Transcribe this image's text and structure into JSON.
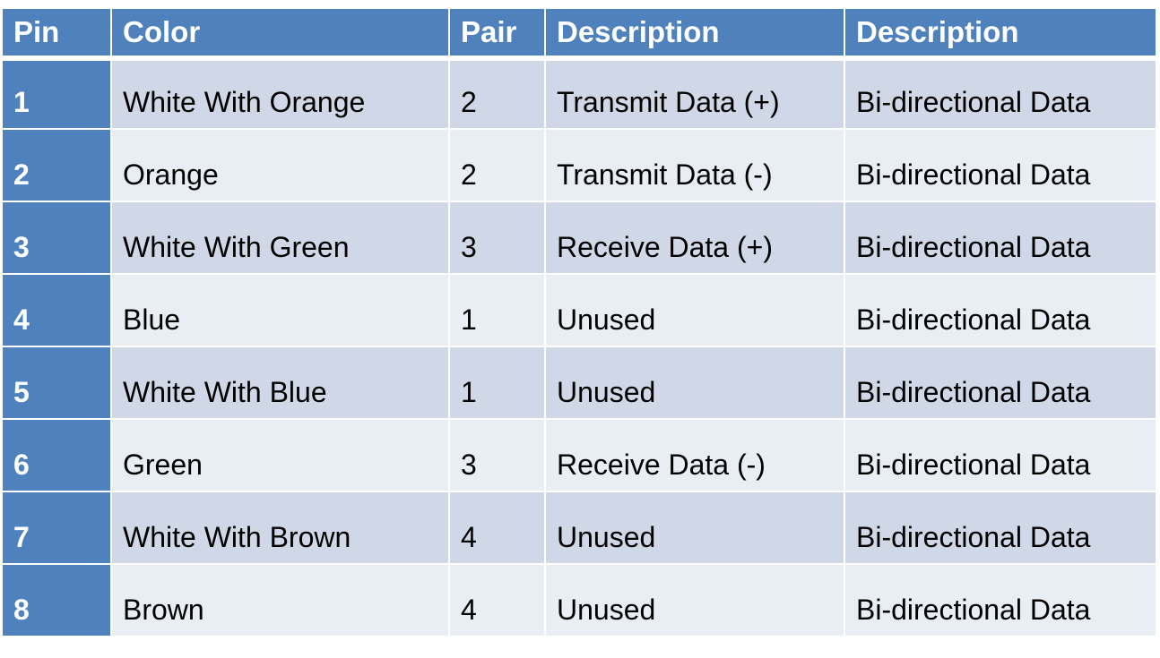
{
  "table": {
    "headers": [
      "Pin",
      "Color",
      "Pair",
      "Description",
      "Description"
    ],
    "rows": [
      [
        "1",
        "White With Orange",
        "2",
        "Transmit Data (+)",
        "Bi-directional Data"
      ],
      [
        "2",
        "Orange",
        "2",
        "Transmit Data (-)",
        "Bi-directional Data"
      ],
      [
        "3",
        "White With Green",
        "3",
        "Receive Data (+)",
        "Bi-directional Data"
      ],
      [
        "4",
        "Blue",
        "1",
        "Unused",
        "Bi-directional Data"
      ],
      [
        "5",
        "White With Blue",
        "1",
        "Unused",
        "Bi-directional Data"
      ],
      [
        "6",
        "Green",
        "3",
        "Receive Data (-)",
        "Bi-directional Data"
      ],
      [
        "7",
        "White With Brown",
        "4",
        "Unused",
        "Bi-directional Data"
      ],
      [
        "8",
        "Brown",
        "4",
        "Unused",
        "Bi-directional Data"
      ]
    ]
  },
  "colors": {
    "header": "#4F81BD",
    "row_odd": "#D0D8E8",
    "row_even": "#E9EDF4"
  }
}
